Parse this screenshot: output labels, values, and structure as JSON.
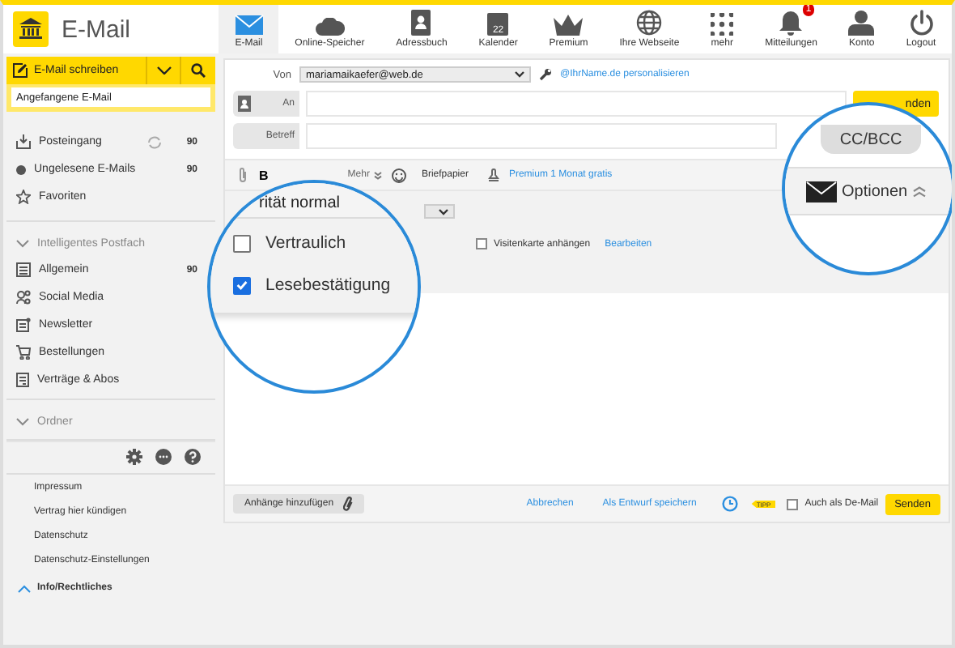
{
  "app_title": "E-Mail",
  "nav": [
    {
      "label": "E-Mail",
      "kind": "mail",
      "selected": true
    },
    {
      "label": "Online-Speicher",
      "kind": "cloud",
      "selected": false
    },
    {
      "label": "Adressbuch",
      "kind": "contacts",
      "selected": false
    },
    {
      "label": "Kalender",
      "kind": "calendar",
      "icon_text": "22",
      "selected": false
    },
    {
      "label": "Premium",
      "kind": "crown",
      "selected": false
    },
    {
      "label": "Ihre Webseite",
      "kind": "globe",
      "selected": false
    },
    {
      "label": "mehr",
      "kind": "grid",
      "selected": false
    },
    {
      "label": "Mitteilungen",
      "kind": "bell",
      "badge": "1",
      "selected": false
    },
    {
      "label": "Konto",
      "kind": "person",
      "selected": false
    },
    {
      "label": "Logout",
      "kind": "power",
      "selected": false
    }
  ],
  "sidebar": {
    "compose_button": "E-Mail schreiben",
    "draft_field": {
      "value": "Angefangene E-Mail"
    },
    "folders": [
      {
        "label": "Posteingang",
        "kind": "inbox",
        "count": "90",
        "syncing": true
      },
      {
        "label": "Ungelesene E-Mails",
        "kind": "dot",
        "count": "90",
        "syncing": false
      },
      {
        "label": "Favoriten",
        "kind": "star",
        "syncing": false
      }
    ],
    "sections": [
      {
        "title": "Intelligentes Postfach",
        "expanded": true,
        "items": [
          {
            "label": "Allgemein",
            "kind": "list",
            "count": "90"
          },
          {
            "label": "Social Media",
            "kind": "social"
          },
          {
            "label": "Newsletter",
            "kind": "newsletter"
          },
          {
            "label": "Bestellungen",
            "kind": "cart"
          },
          {
            "label": "Verträge & Abos",
            "kind": "contract"
          }
        ]
      },
      {
        "title": "Ordner",
        "expanded": true
      }
    ],
    "footer_links": [
      "Impressum",
      "Vertrag hier kündigen",
      "Datenschutz",
      "Datenschutz-Einstellungen"
    ],
    "info_section": {
      "title": "Info/Rechtliches",
      "expanded": true
    }
  },
  "compose": {
    "from_label": "Von",
    "from_value": "mariamaikaefer@web.de",
    "personalize_link": "@IhrName.de personalisieren",
    "to_label": "An",
    "send_top": "nden",
    "subject_label": "Betreff",
    "toolbar": {
      "bold": "B",
      "more": "Mehr",
      "stationery": "Briefpapier",
      "premium_link": "Premium 1 Monat gratis"
    },
    "business_card": {
      "label": "Visitenkarte anhängen",
      "checked": false
    },
    "edit_link": "Bearbeiten"
  },
  "magnifier_options": {
    "priority": "rität normal",
    "checkboxes": [
      {
        "label": "Vertraulich",
        "checked": false
      },
      {
        "label": "Lesebestätigung",
        "checked": true
      }
    ]
  },
  "magnifier_buttons": {
    "cc_bcc": "CC/BCC",
    "options": "Optionen"
  },
  "footer": {
    "attach": "Anhänge hinzufügen",
    "cancel": "Abbrechen",
    "save_draft": "Als Entwurf speichern",
    "tip": "TIPP",
    "de_mail": {
      "label": "Auch als De-Mail",
      "checked": false
    },
    "send": "Senden"
  }
}
